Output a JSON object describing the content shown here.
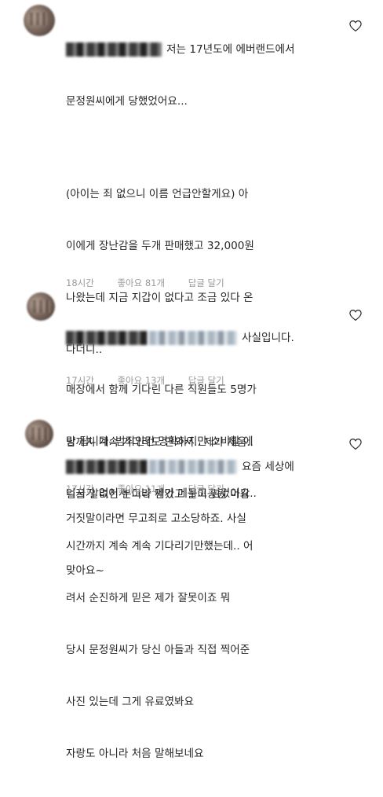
{
  "comments": [
    {
      "text_first": "저는 17년도에 에버랜드에서",
      "text_lines": [
        "문정원씨에게 당했었어요...",
        "",
        "(아이는 죄 없으니 이름 언급안할게요) 아",
        "이에게 장난감을 두개 판매했고 32,000원",
        "나왔는데 지금 지갑이 없다고 조금 있다 온",
        "다더니..",
        "",
        "밤까지 계속 기다려도 안와서.. 제가 체움..",
        "얼굴 알려진 분이라 믿었고 놀이공원 마감",
        "시간까지 계속 계속 기다리기만했는데.. 어",
        "려서 순진하게 믿은 제가 잘못이죠 뭐",
        "당시 문정원씨가 당신 아들과 직접 찍어준",
        "사진 있는데 그게 유료였봐요",
        "자랑도 아니라 처음 말해보네요"
      ],
      "time": "18시간",
      "likes": "좋아요 81개",
      "reply": "답글 달기",
      "heart_icon": "heart-outline-icon"
    },
    {
      "text_first": "사실입니다.",
      "text_lines": [
        "매장에서 함께 기다린 다른 직원들도 5명가",
        "량 됩니다. 범죄인건 명확하지만 소비할 에",
        "너지가 없어서 그냥 제가 메꾸고 넘겼어요.."
      ],
      "time": "17시간",
      "likes": "좋아요 13개",
      "reply": "답글 달기",
      "heart_icon": "heart-outline-icon"
    },
    {
      "text_first": "요즘 세상에",
      "text_lines": [
        "거짓말이라면 무고죄로 고소당하죠. 사실",
        "맞아요~"
      ],
      "time": "17시간",
      "likes": "좋아요 11개",
      "reply": "답글 달기",
      "heart_icon": "heart-outline-icon"
    }
  ]
}
